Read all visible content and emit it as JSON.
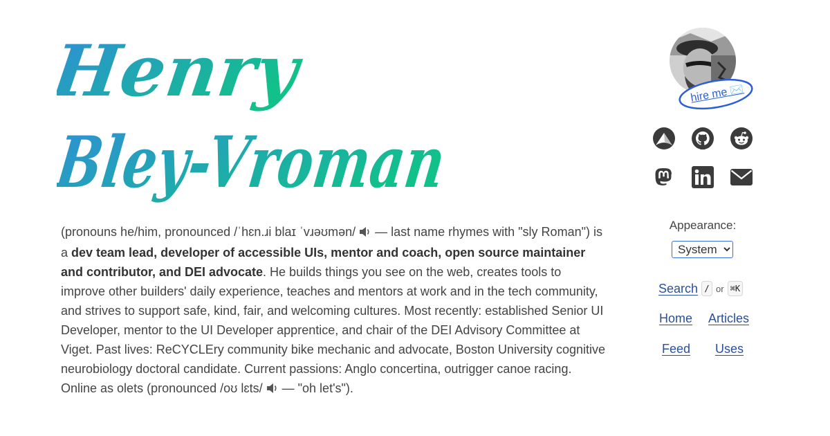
{
  "header": {
    "name_line1": "Henry",
    "name_line2": "Bley-Vroman"
  },
  "bio": {
    "p1": "(pronouns he/him, pronounced /ˈhɛn.ɹi blaɪ ˈvɹəʊmən/ ",
    "p2": " — last name rhymes with \"sly Roman\") is a ",
    "bold": "dev team lead, developer of accessible UIs, mentor and coach, open source maintainer and contributor, and DEI advocate",
    "p3": ". He builds things you see on the web, creates tools to improve other builders' daily experience, teaches and mentors at work and in the tech community, and strives to support safe, kind, fair, and welcoming cultures. Most recently: established Senior UI Developer, mentor to the UI Developer apprentice, and chair of the DEI Advisory Committee at Viget. Past lives: ReCYCLEry community bike mechanic and advocate, Boston University cognitive neurobiology doctoral candidate. Current passions: Anglo concertina, outrigger canoe racing. Online as olets (pronounced /oʊ lɛts/ ",
    "p4": " — \"oh let's\")."
  },
  "sidebar": {
    "hire_label": "hire me ✉️",
    "social": [
      {
        "name": "arc-logo-icon"
      },
      {
        "name": "github-icon"
      },
      {
        "name": "reddit-icon"
      },
      {
        "name": "mastodon-icon"
      },
      {
        "name": "linkedin-icon"
      },
      {
        "name": "email-icon"
      }
    ],
    "appearance_label": "Appearance:",
    "appearance_value": "System",
    "search_label": "Search",
    "search_key": "/",
    "or_label": "or",
    "search_shortcut": "⌘K",
    "nav": {
      "home": "Home",
      "articles": "Articles",
      "feed": "Feed",
      "uses": "Uses"
    }
  },
  "colors": {
    "gradient_start": "#2f8fd6",
    "gradient_end": "#12c08a",
    "link": "#2a4f9e",
    "icon": "#3b3b3b"
  }
}
